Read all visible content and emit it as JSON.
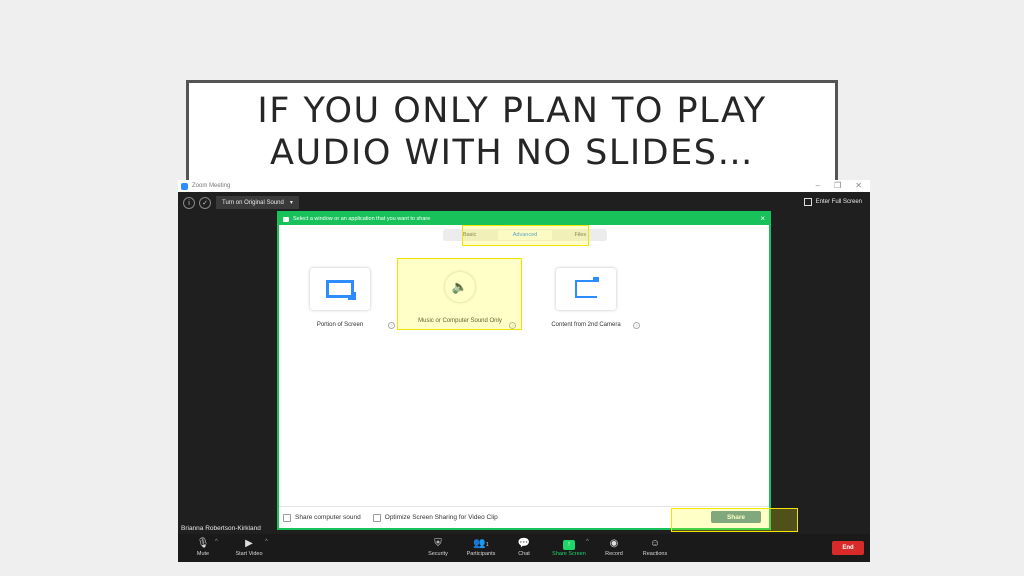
{
  "slide": {
    "title_line1": "IF YOU ONLY PLAN TO PLAY",
    "title_line2": "AUDIO WITH NO SLIDES…"
  },
  "window": {
    "title": "Zoom Meeting",
    "controls": [
      "–",
      "❐",
      "✕"
    ]
  },
  "top_toolbar": {
    "original_sound": "Turn on Original Sound",
    "full_screen": "Enter Full Screen"
  },
  "dialog": {
    "header": "Select a window or an application that you want to share",
    "tabs": [
      {
        "label": "Basic",
        "active": false
      },
      {
        "label": "Advanced",
        "active": true
      },
      {
        "label": "Files",
        "active": false
      }
    ],
    "options": [
      {
        "label": "Portion of Screen",
        "icon": "portion-of-screen-icon"
      },
      {
        "label": "Music or Computer Sound Only",
        "icon": "speaker-icon"
      },
      {
        "label": "Content from 2nd Camera",
        "icon": "camera-icon"
      }
    ],
    "footer": {
      "share_sound": "Share computer sound",
      "optimize": "Optimize Screen Sharing for Video Clip",
      "share_button": "Share"
    }
  },
  "participant_name": "Brianna Robertson-Kirkland",
  "bottom_toolbar": {
    "mute": "Mute",
    "start_video": "Start Video",
    "security": "Security",
    "participants": "Participants",
    "participants_count": "1",
    "chat": "Chat",
    "share_screen": "Share Screen",
    "record": "Record",
    "reactions": "Reactions",
    "end": "End"
  },
  "colors": {
    "accent_green": "#19c15b",
    "highlight_yellow": "#f2e600",
    "zoom_blue": "#2d8cff",
    "end_red": "#d92a2a"
  }
}
